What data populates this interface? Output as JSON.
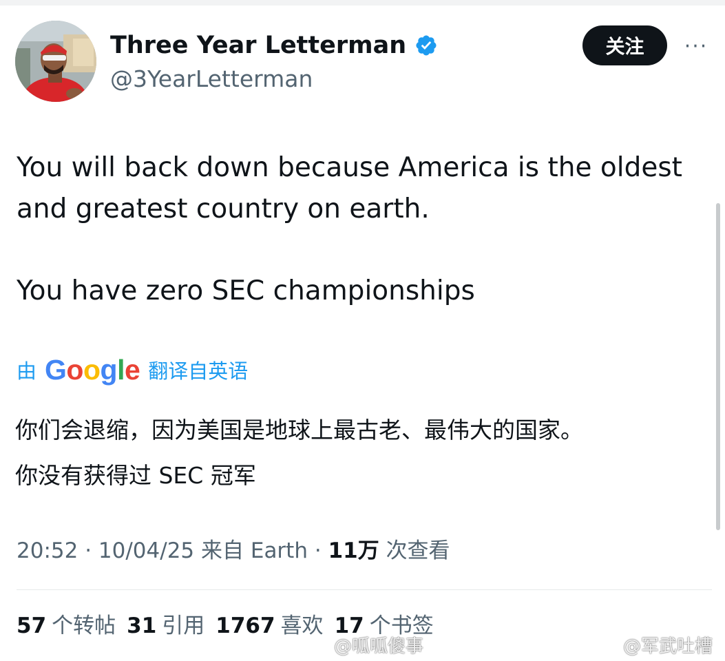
{
  "author": {
    "display_name": "Three Year Letterman",
    "handle": "@3YearLetterman",
    "verified": true,
    "avatar_icon": "profile-photo"
  },
  "actions": {
    "follow_label": "关注",
    "more_label": "···"
  },
  "tweet": {
    "paragraph1": "You will back down because America is the oldest and greatest country on earth.",
    "paragraph2": "You have zero SEC championships"
  },
  "translation": {
    "prefix": "由",
    "provider": "Google",
    "suffix": "翻译自英语",
    "line1": "你们会退缩，因为美国是地球上最古老、最伟大的国家。",
    "line2": "你没有获得过 SEC 冠军"
  },
  "meta": {
    "time": "20:52",
    "separator": " · ",
    "date": "10/04/25",
    "source": "来自 Earth",
    "views_count": "11万",
    "views_label": "次查看"
  },
  "stats": {
    "reposts_count": "57",
    "reposts_label": "个转帖",
    "quotes_count": "31",
    "quotes_label": "引用",
    "likes_count": "1767",
    "likes_label": "喜欢",
    "bookmarks_count": "17",
    "bookmarks_label": "个书签"
  },
  "watermarks": {
    "left": "@呱呱傻事",
    "right": "@军武吐槽"
  },
  "colors": {
    "link_blue": "#1d9bf0",
    "text": "#0f1419",
    "muted": "#536471",
    "button_bg": "#0f1419"
  }
}
